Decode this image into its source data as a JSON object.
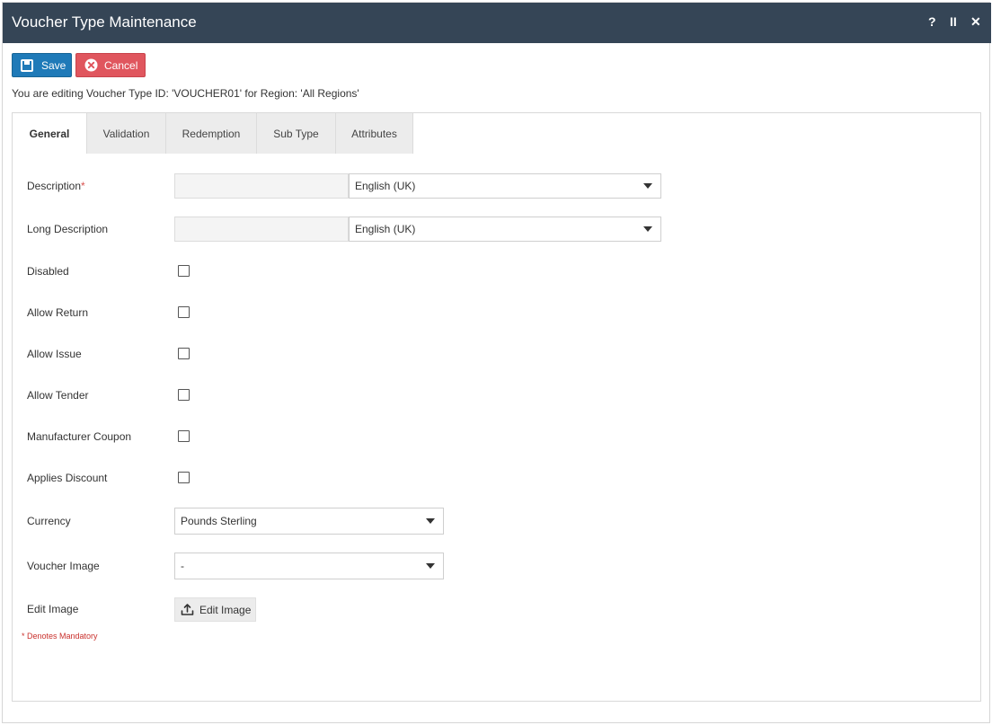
{
  "window": {
    "title": "Voucher Type Maintenance",
    "controls": {
      "help": "?",
      "pause": "II",
      "close": "✕"
    }
  },
  "toolbar": {
    "save_label": "Save",
    "cancel_label": "Cancel"
  },
  "info_text": "You are editing Voucher Type ID: 'VOUCHER01' for Region: 'All Regions'",
  "tabs": [
    {
      "label": "General",
      "active": true
    },
    {
      "label": "Validation",
      "active": false
    },
    {
      "label": "Redemption",
      "active": false
    },
    {
      "label": "Sub Type",
      "active": false
    },
    {
      "label": "Attributes",
      "active": false
    }
  ],
  "form": {
    "description": {
      "label": "Description",
      "required_mark": "*",
      "value": "",
      "language": "English (UK)"
    },
    "long_description": {
      "label": "Long Description",
      "value": "",
      "language": "English (UK)"
    },
    "checkboxes": [
      {
        "label": "Disabled",
        "checked": false
      },
      {
        "label": "Allow Return",
        "checked": false
      },
      {
        "label": "Allow Issue",
        "checked": false
      },
      {
        "label": "Allow Tender",
        "checked": false
      },
      {
        "label": "Manufacturer Coupon",
        "checked": false
      },
      {
        "label": "Applies Discount",
        "checked": false
      }
    ],
    "currency": {
      "label": "Currency",
      "value": "Pounds Sterling"
    },
    "voucher_image": {
      "label": "Voucher Image",
      "value": "-"
    },
    "edit_image": {
      "label": "Edit Image",
      "button_label": "Edit Image"
    },
    "mandatory_note": "* Denotes Mandatory"
  },
  "colors": {
    "titlebar": "#354556",
    "save": "#1f7ab8",
    "cancel": "#e0565e",
    "required": "#d9534f"
  },
  "icons": {
    "save": "floppy-disk-icon",
    "cancel": "cancel-circle-icon",
    "dropdown": "caret-down-icon",
    "edit_image": "upload-icon"
  }
}
